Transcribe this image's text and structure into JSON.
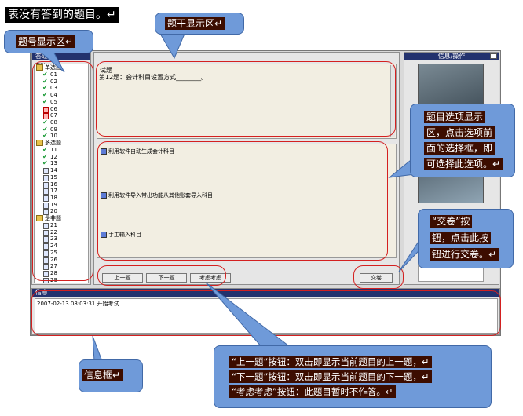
{
  "caption": "表没有答到的题目。↵",
  "labels": {
    "question_area": "题号显示区↵",
    "stem_area": "题干显示区↵",
    "info_box": "信息框↵",
    "option_area": [
      "题目选项显示",
      "区，点击选项前",
      "面的选择框，即",
      "可选择此选项。↵"
    ],
    "submit_note": [
      "“交卷”按",
      "钮，点击此按",
      "钮进行交卷。↵"
    ],
    "nav_note": [
      "“上一题”按钮：双击即显示当前题目的上一题，↵",
      "“下一题”按钮：双击即显示当前题目的下一题，↵",
      "“考虑考虑”按钮：此题目暂时不作答。↵"
    ]
  },
  "window": {
    "left_title": "答题",
    "tree_header": "索引",
    "right_title": "信息/操作",
    "info_title": "信息"
  },
  "tree": {
    "groups": [
      {
        "name": "单选题",
        "items": [
          "01",
          "02",
          "03",
          "04",
          "05",
          "06",
          "07",
          "08",
          "09",
          "10"
        ],
        "status": [
          "done",
          "done",
          "done",
          "done",
          "done",
          "todo",
          "todo",
          "done",
          "done",
          "done"
        ]
      },
      {
        "name": "多选题",
        "items": [
          "11",
          "12",
          "13",
          "14",
          "15",
          "16",
          "17",
          "18",
          "19",
          "20"
        ],
        "status": [
          "done",
          "done",
          "done",
          "todo",
          "todo",
          "todo",
          "todo",
          "todo",
          "todo",
          "todo"
        ]
      },
      {
        "name": "是非题",
        "items": [
          "21",
          "22",
          "23",
          "24",
          "25",
          "26",
          "27",
          "28",
          "29",
          "30"
        ],
        "status": [
          "todo",
          "todo",
          "todo",
          "todo",
          "todo",
          "todo",
          "todo",
          "todo",
          "todo",
          "todo"
        ]
      }
    ],
    "last": "交卷题"
  },
  "question": {
    "label": "试题",
    "text": "第12题：会计科目设置方式________。"
  },
  "options": [
    "利用软件自动生成会计科目",
    "利用软件导入带出功能从其他账套导入科目",
    "手工输入科目"
  ],
  "buttons": {
    "prev": "上一题",
    "next": "下一题",
    "consider": "考虑考虑",
    "submit": "交卷"
  },
  "log": {
    "line": "2007-02-13 08:03:31 开始考试"
  },
  "colors": {
    "title_bar": "#23326e",
    "highlight_red": "#d42020",
    "callout_bg": "#3c0d00",
    "balloon": "#6f9ad9"
  }
}
